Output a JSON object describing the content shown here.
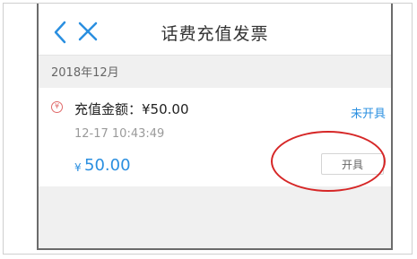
{
  "header": {
    "title": "话费充值发票"
  },
  "list": {
    "month": "2018年12月",
    "items": [
      {
        "badge": "¥",
        "amount_label": "充值金额：¥50.00",
        "status": "未开具",
        "time": "12-17 10:43:49",
        "currency": "¥",
        "price": "50.00",
        "issue_label": "开具"
      }
    ]
  },
  "colors": {
    "accent": "#2a8fe0",
    "annotation": "#d62727",
    "badge": "#e06a6a"
  },
  "icons": {
    "back": "back-chevron-icon",
    "close": "close-icon"
  }
}
